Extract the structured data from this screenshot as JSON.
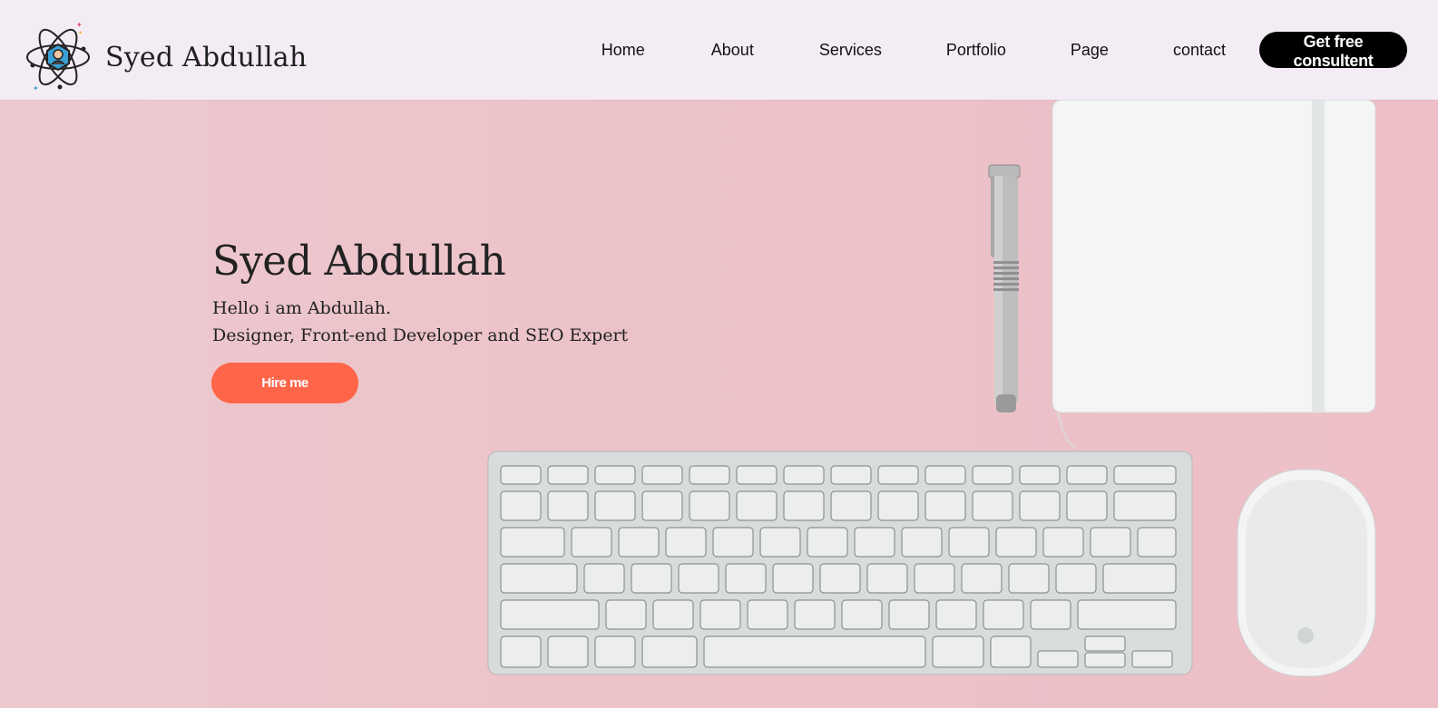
{
  "brand": {
    "name": "Syed Abdullah"
  },
  "nav": {
    "items": [
      "Home",
      "About",
      "Services",
      "Portfolio",
      "Page",
      "contact"
    ],
    "cta": "Get free consultent"
  },
  "hero": {
    "title": "Syed Abdullah",
    "line1": "Hello i am Abdullah.",
    "line2": "Designer, Front-end Developer and SEO Expert",
    "button": "Hire me"
  },
  "colors": {
    "hero_bg": "#ecc4ca",
    "navbar_bg": "#f3ecf4",
    "cta_bg": "#000000",
    "hire_bg": "#ff6549"
  }
}
